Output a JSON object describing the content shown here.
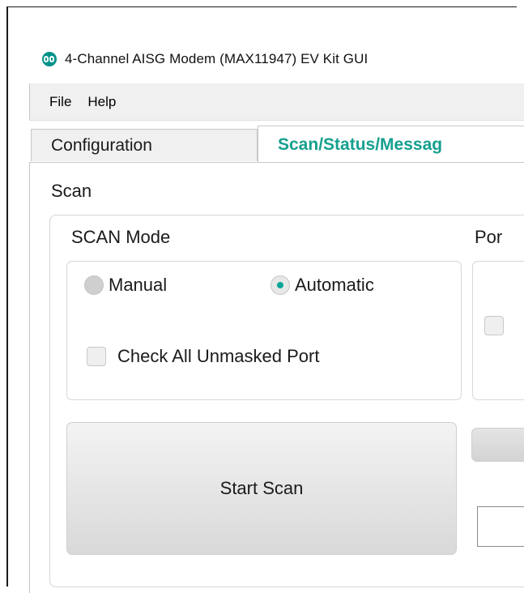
{
  "window": {
    "title": "4-Channel AISG Modem (MAX11947) EV Kit GUI",
    "logo_icon": "maxim-logo-icon",
    "accent_color": "#15a08e"
  },
  "menu": {
    "items": [
      "File",
      "Help"
    ]
  },
  "tabs": [
    {
      "label": "Configuration",
      "active": false
    },
    {
      "label": "Scan/Status/Messag",
      "active": true
    }
  ],
  "scan": {
    "section_title": "Scan",
    "mode_group_label": "SCAN Mode",
    "port_group_label": "Por",
    "radios": [
      {
        "label": "Manual",
        "selected": false
      },
      {
        "label": "Automatic",
        "selected": true
      }
    ],
    "check_all_label": "Check All Unmasked Port",
    "check_all_checked": false,
    "start_button_label": "Start Scan"
  }
}
